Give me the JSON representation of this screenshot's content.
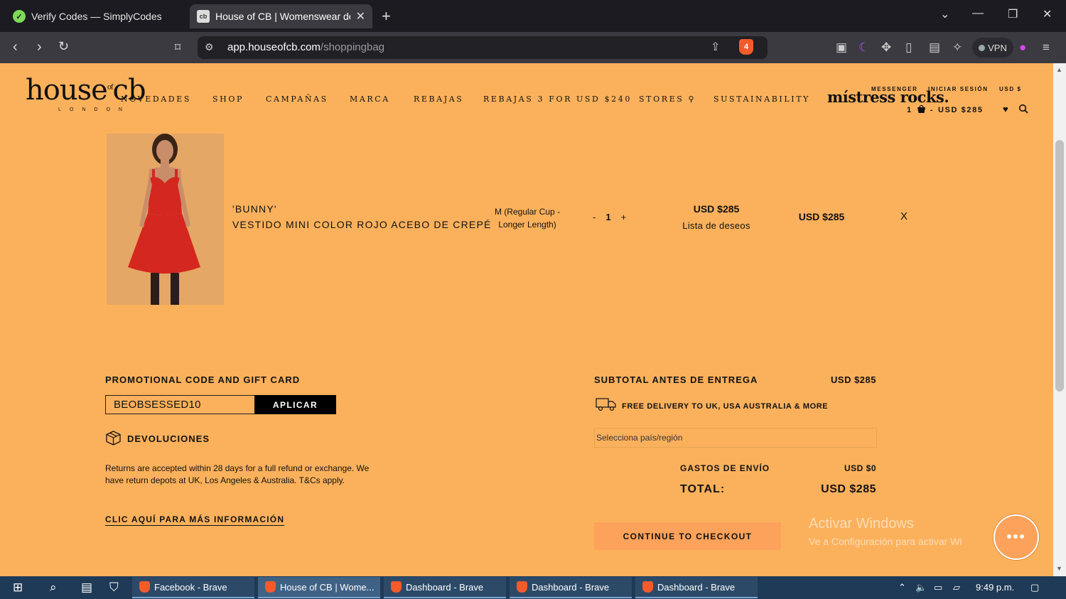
{
  "browser": {
    "tabs": [
      {
        "title": "Verify Codes — SimplyCodes",
        "favicon": "simplycodes-icon"
      },
      {
        "title": "House of CB | Womenswear de",
        "favicon": "cb-icon",
        "close": "✕"
      }
    ],
    "new_tab": "+",
    "url_domain": "app.houseofcb.com",
    "url_path": "/shoppingbag",
    "brave_badge": "4",
    "vpn_label": "VPN"
  },
  "site": {
    "logo": "house of cb",
    "logo_of": "of",
    "logo_sub": "LONDON",
    "nav": [
      "NOVEDADES",
      "SHOP",
      "CAMPAÑAS",
      "MARCA",
      "REBAJAS",
      "REBAJAS 3 FOR USD $240",
      "STORES",
      "SUSTAINABILITY"
    ],
    "mistress": "místress rocks.",
    "messenger": "MESSENGER",
    "login": "INICIAR SESIÓN",
    "currency": "USD $",
    "bag_count": "1",
    "bag_total": "USD $285"
  },
  "cart": {
    "item": {
      "brand": "'BUNNY'",
      "name": "VESTIDO MINI COLOR ROJO ACEBO DE CREPÉ",
      "size": "M (Regular Cup - Longer Length)",
      "qty_minus": "-",
      "qty": "1",
      "qty_plus": "+",
      "price": "USD $285",
      "wishlist": "Lista de deseos",
      "line_total": "USD $285",
      "remove": "X"
    }
  },
  "promo": {
    "title": "PROMOTIONAL CODE AND GIFT CARD",
    "code_value": "BEOBSESSED10",
    "apply_label": "APLICAR"
  },
  "returns": {
    "title": "DEVOLUCIONES",
    "text": "Returns are accepted within 28 days for a full refund or exchange. We have return depots at UK, Los Angeles & Australia. T&Cs apply.",
    "link": "CLIC AQUÍ PARA MÁS INFORMACIÓN"
  },
  "summary": {
    "subtotal_label": "SUBTOTAL ANTES DE ENTREGA",
    "subtotal_value": "USD $285",
    "delivery_text": "FREE DELIVERY TO UK, USA AUSTRALIA & MORE",
    "country_placeholder": "Selecciona país/región",
    "shipping_label": "GASTOS DE ENVÍO",
    "shipping_value": "USD $0",
    "total_label": "TOTAL:",
    "total_value": "USD $285",
    "checkout_label": "CONTINUE TO CHECKOUT"
  },
  "watermark": {
    "line1": "Activar Windows",
    "line2": "Ve a Configuración para activar Wi"
  },
  "chat_label": "•••",
  "taskbar": {
    "apps": [
      {
        "label": "Facebook - Brave"
      },
      {
        "label": "House of CB | Wome..."
      },
      {
        "label": "Dashboard - Brave"
      },
      {
        "label": "Dashboard - Brave"
      },
      {
        "label": "Dashboard - Brave"
      }
    ],
    "time": "9:49 p.m."
  },
  "colors": {
    "page_bg": "#fbb15c",
    "checkout_bg": "#fca25a",
    "dress": "#d4271f"
  }
}
